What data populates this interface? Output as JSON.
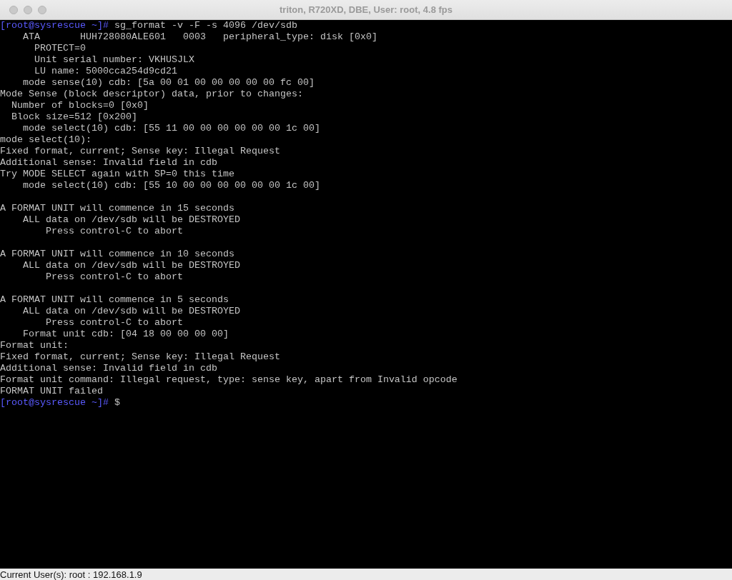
{
  "window": {
    "title": "triton, R720XD, DBE, User: root, 4.8 fps"
  },
  "terminal": {
    "lines": [
      {
        "kind": "prompt",
        "prompt": "[root@sysrescue ~]#",
        "text": "sg_format -v -F -s 4096 /dev/sdb"
      },
      {
        "kind": "output",
        "text": "    ATA       HUH728080ALE601   0003   peripheral_type: disk [0x0]"
      },
      {
        "kind": "output",
        "text": "      PROTECT=0"
      },
      {
        "kind": "output",
        "text": "      Unit serial number: VKHUSJLX"
      },
      {
        "kind": "output",
        "text": "      LU name: 5000cca254d9cd21"
      },
      {
        "kind": "output",
        "text": "    mode sense(10) cdb: [5a 00 01 00 00 00 00 00 fc 00]"
      },
      {
        "kind": "output",
        "text": "Mode Sense (block descriptor) data, prior to changes:"
      },
      {
        "kind": "output",
        "text": "  Number of blocks=0 [0x0]"
      },
      {
        "kind": "output",
        "text": "  Block size=512 [0x200]"
      },
      {
        "kind": "output",
        "text": "    mode select(10) cdb: [55 11 00 00 00 00 00 00 1c 00]"
      },
      {
        "kind": "output",
        "text": "mode select(10):"
      },
      {
        "kind": "output",
        "text": "Fixed format, current; Sense key: Illegal Request"
      },
      {
        "kind": "output",
        "text": "Additional sense: Invalid field in cdb"
      },
      {
        "kind": "output",
        "text": "Try MODE SELECT again with SP=0 this time"
      },
      {
        "kind": "output",
        "text": "    mode select(10) cdb: [55 10 00 00 00 00 00 00 1c 00]"
      },
      {
        "kind": "blank"
      },
      {
        "kind": "output",
        "text": "A FORMAT UNIT will commence in 15 seconds"
      },
      {
        "kind": "output",
        "text": "    ALL data on /dev/sdb will be DESTROYED"
      },
      {
        "kind": "output",
        "text": "        Press control-C to abort"
      },
      {
        "kind": "blank"
      },
      {
        "kind": "output",
        "text": "A FORMAT UNIT will commence in 10 seconds"
      },
      {
        "kind": "output",
        "text": "    ALL data on /dev/sdb will be DESTROYED"
      },
      {
        "kind": "output",
        "text": "        Press control-C to abort"
      },
      {
        "kind": "blank"
      },
      {
        "kind": "output",
        "text": "A FORMAT UNIT will commence in 5 seconds"
      },
      {
        "kind": "output",
        "text": "    ALL data on /dev/sdb will be DESTROYED"
      },
      {
        "kind": "output",
        "text": "        Press control-C to abort"
      },
      {
        "kind": "output",
        "text": "    Format unit cdb: [04 18 00 00 00 00]"
      },
      {
        "kind": "output",
        "text": "Format unit:"
      },
      {
        "kind": "output",
        "text": "Fixed format, current; Sense key: Illegal Request"
      },
      {
        "kind": "output",
        "text": "Additional sense: Invalid field in cdb"
      },
      {
        "kind": "output",
        "text": "Format unit command: Illegal request, type: sense key, apart from Invalid opcode"
      },
      {
        "kind": "output",
        "text": "FORMAT UNIT failed"
      },
      {
        "kind": "prompt",
        "prompt": "[root@sysrescue ~]#",
        "text": "$"
      }
    ]
  },
  "status_bar": {
    "text": "Current User(s): root : 192.168.1.9"
  }
}
